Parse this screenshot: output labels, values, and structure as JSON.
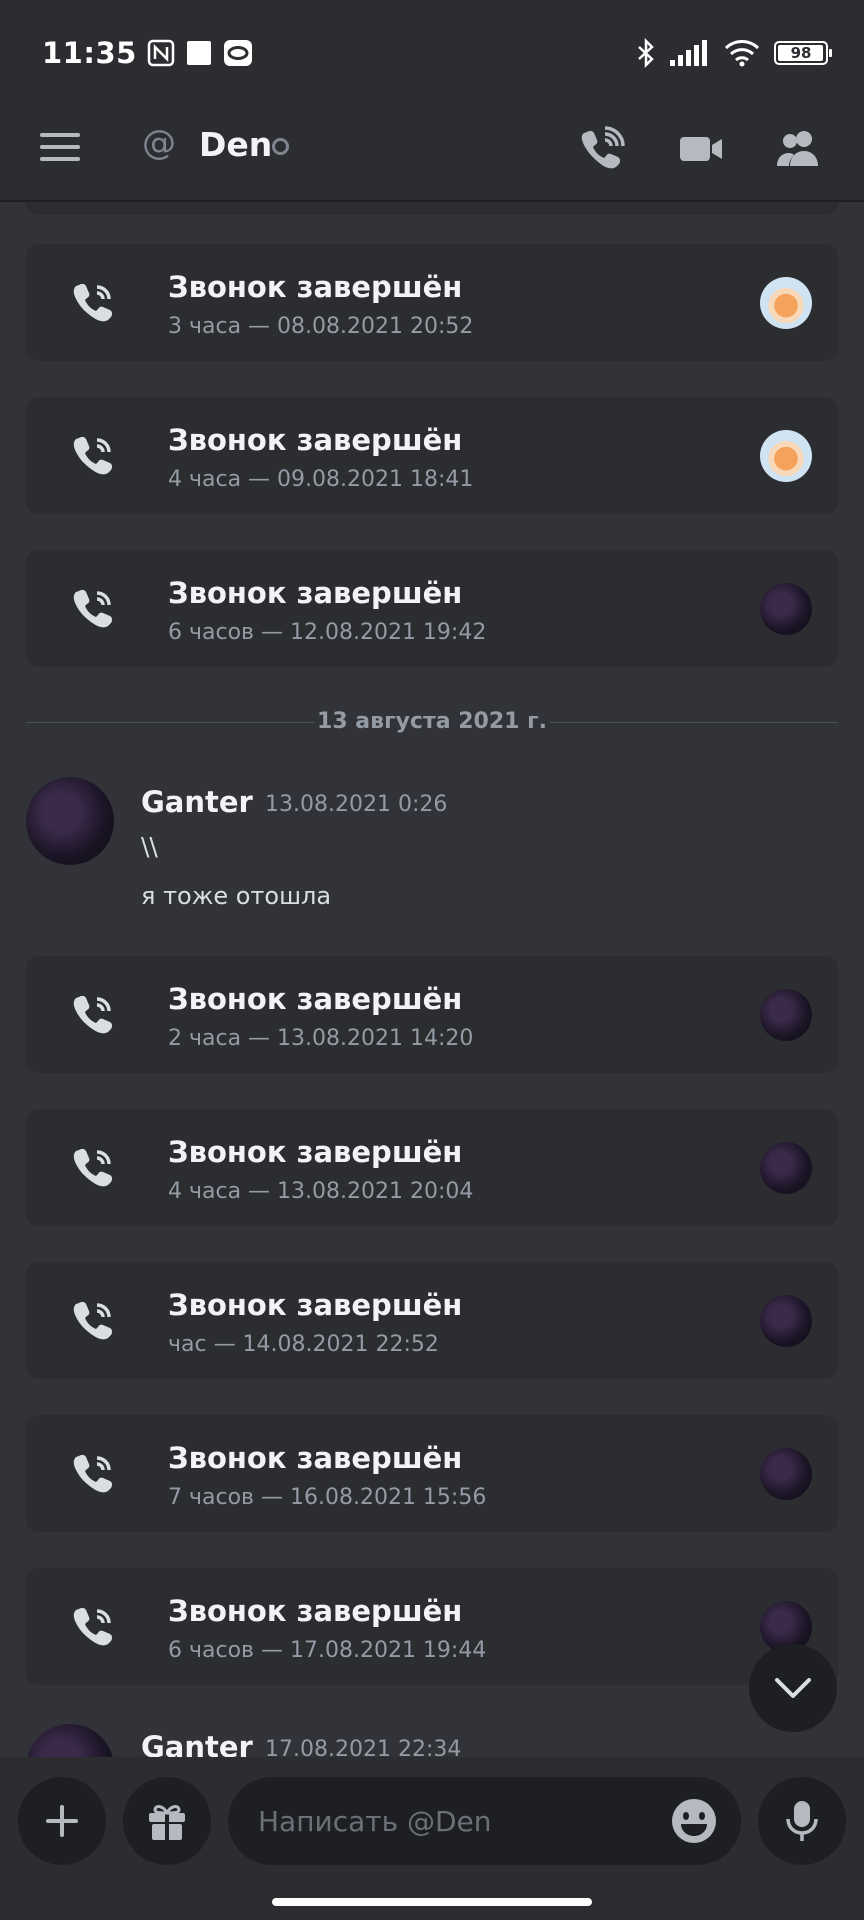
{
  "status_bar": {
    "time": "11:35",
    "battery": "98",
    "battery_level": 0.98,
    "left_icons": [
      "nfc-icon",
      "square-notification-icon",
      "app-notification-icon"
    ],
    "right_icons": [
      "bluetooth-icon",
      "signal-icon",
      "wifi-icon",
      "battery-icon"
    ]
  },
  "header": {
    "channel_name": "Den",
    "icons": [
      "menu-icon",
      "at-icon",
      "status-offline-icon",
      "voice-call-icon",
      "video-call-icon",
      "members-icon"
    ]
  },
  "calls_before": [
    {
      "title": "Звонок завершён",
      "meta": "3 часа — 08.08.2021 20:52",
      "avatar": "fox"
    },
    {
      "title": "Звонок завершён",
      "meta": "4 часа — 09.08.2021 18:41",
      "avatar": "fox"
    },
    {
      "title": "Звонок завершён",
      "meta": "6 часов — 12.08.2021 19:42",
      "avatar": "dark"
    }
  ],
  "date_divider": "13 августа 2021 г.",
  "message": {
    "author": "Ganter",
    "timestamp": "13.08.2021 0:26",
    "lines": [
      "\\\\",
      "я тоже отошла"
    ]
  },
  "calls_after": [
    {
      "title": "Звонок завершён",
      "meta": "2 часа — 13.08.2021 14:20",
      "avatar": "dark"
    },
    {
      "title": "Звонок завершён",
      "meta": "4 часа — 13.08.2021 20:04",
      "avatar": "dark"
    },
    {
      "title": "Звонок завершён",
      "meta": "час — 14.08.2021 22:52",
      "avatar": "dark"
    },
    {
      "title": "Звонок завершён",
      "meta": "7 часов — 16.08.2021 15:56",
      "avatar": "dark"
    },
    {
      "title": "Звонок завершён",
      "meta": "6 часов — 17.08.2021 19:44",
      "avatar": "dark"
    }
  ],
  "next_message": {
    "author": "Ganter",
    "timestamp": "17.08.2021 22:34"
  },
  "composer": {
    "placeholder": "Написать @Den",
    "icons": [
      "plus-icon",
      "gift-icon",
      "emoji-icon",
      "microphone-icon"
    ]
  },
  "colors": {
    "background": "#313338",
    "card": "#2b2d31",
    "input": "#1e1f22",
    "muted_text": "#949ba4"
  }
}
